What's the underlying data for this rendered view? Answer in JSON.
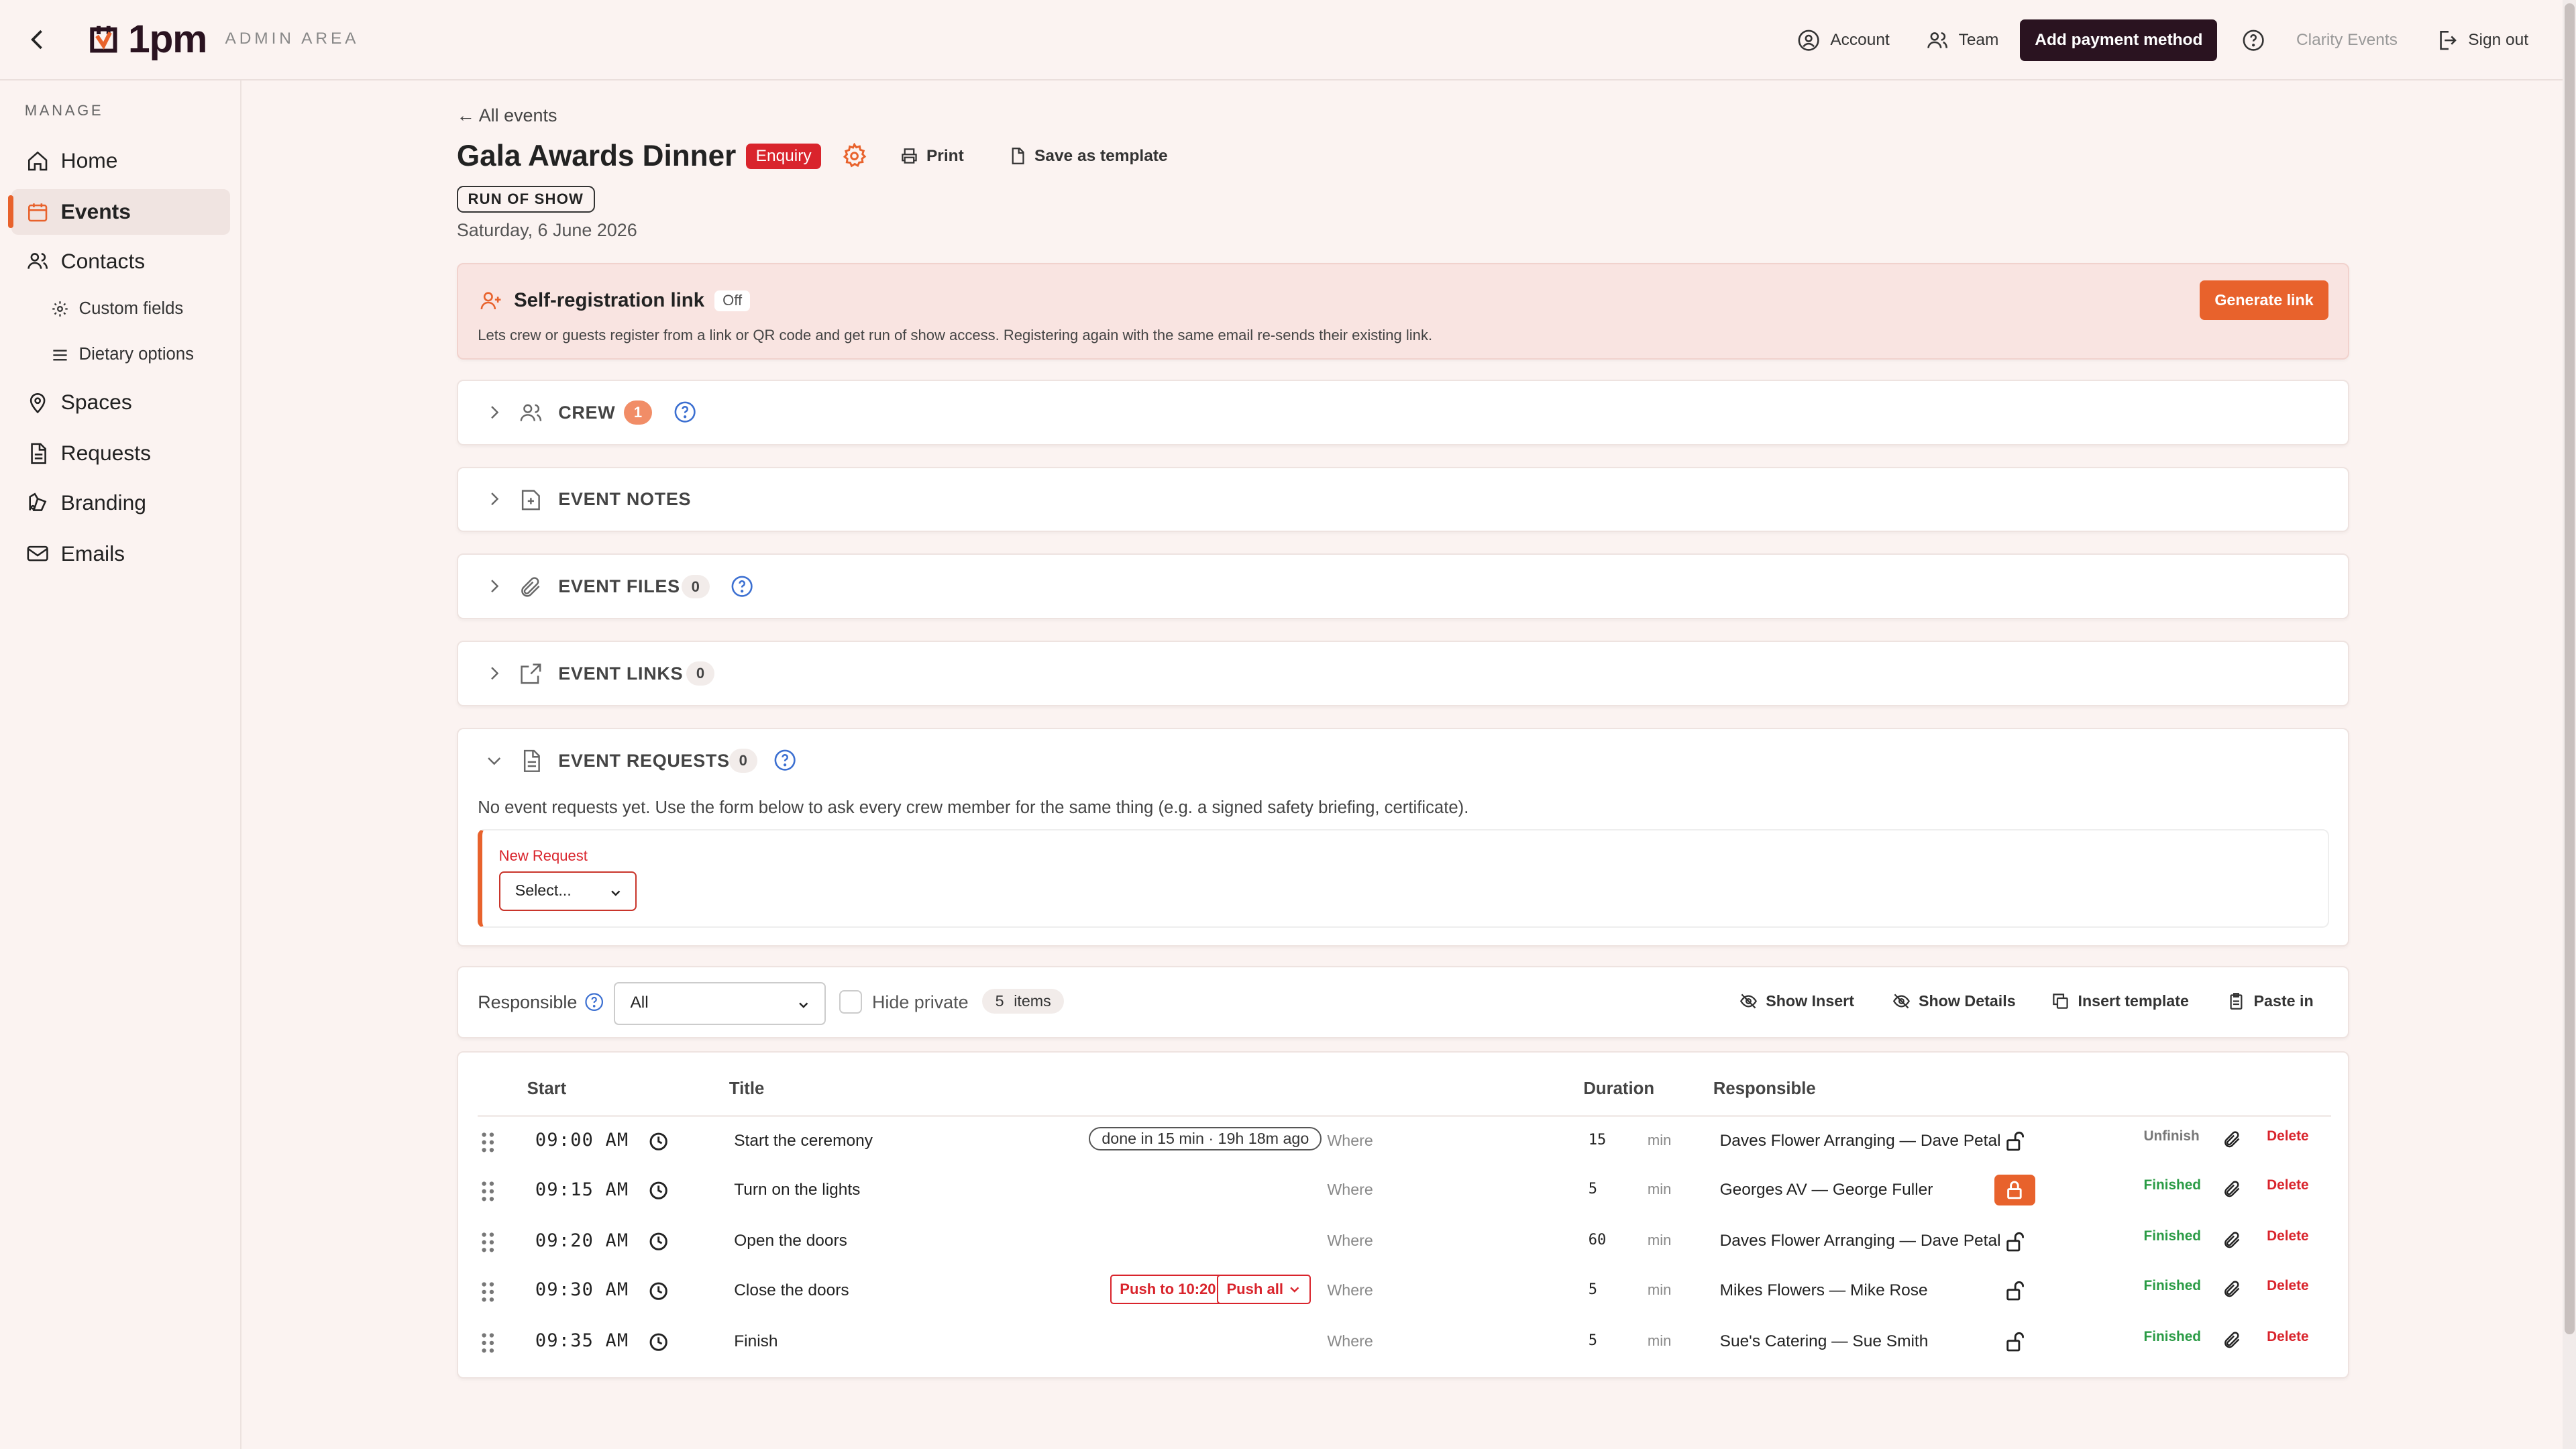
{
  "topbar": {
    "logo_text": "1pm",
    "area_label": "ADMIN AREA",
    "account": "Account",
    "team": "Team",
    "add_payment": "Add payment method",
    "org_name": "Clarity Events",
    "sign_out": "Sign out"
  },
  "sidebar": {
    "section_label": "MANAGE",
    "items": [
      {
        "label": "Home",
        "icon": "home-icon"
      },
      {
        "label": "Events",
        "icon": "calendar-icon",
        "active": true
      },
      {
        "label": "Contacts",
        "icon": "users-icon"
      },
      {
        "label": "Custom fields",
        "icon": "gear-icon"
      },
      {
        "label": "Dietary options",
        "icon": "list-icon"
      },
      {
        "label": "Spaces",
        "icon": "location-pin-icon"
      },
      {
        "label": "Requests",
        "icon": "document-icon"
      },
      {
        "label": "Branding",
        "icon": "palette-icon"
      },
      {
        "label": "Emails",
        "icon": "mail-icon"
      }
    ]
  },
  "event": {
    "back_link": "← All events",
    "title": "Gala Awards Dinner",
    "status": "Enquiry",
    "print": "Print",
    "save_template": "Save as template",
    "tag": "RUN OF SHOW",
    "date": "Saturday, 6 June 2026"
  },
  "self_registration": {
    "title": "Self-registration link",
    "state": "Off",
    "description": "Lets crew or guests register from a link or QR code and get run of show access. Registering again with the same email re-sends their existing link.",
    "button": "Generate link"
  },
  "sections": [
    {
      "label": "CREW",
      "count": "1"
    },
    {
      "label": "EVENT NOTES"
    },
    {
      "label": "EVENT FILES",
      "count": "0"
    },
    {
      "label": "EVENT LINKS",
      "count": "0"
    },
    {
      "label": "EVENT REQUESTS",
      "count": "0"
    }
  ],
  "requests": {
    "empty_text": "No event requests yet. Use the form below to ask every crew member for the same thing (e.g. a signed safety briefing, certificate).",
    "new_label": "New Request",
    "select_placeholder": "Select..."
  },
  "filters": {
    "responsible_label": "Responsible",
    "responsible_value": "All",
    "hide_private": "Hide private",
    "item_count": "5",
    "items_label": "items",
    "show_insert": "Show Insert",
    "show_details": "Show Details",
    "insert_template": "Insert template",
    "paste_in": "Paste in"
  },
  "table": {
    "headers": {
      "start": "Start",
      "title": "Title",
      "duration": "Duration",
      "responsible": "Responsible"
    },
    "where_label": "Where",
    "min_label": "min",
    "delete_label": "Delete",
    "rows": [
      {
        "time": "09:00 AM",
        "title": "Start the ceremony",
        "pill": "done in 15 min · 19h 18m ago",
        "duration": "15",
        "responsible": "Daves Flower Arranging — Dave Petal",
        "status": "Unfinish",
        "locked": false
      },
      {
        "time": "09:15 AM",
        "title": "Turn on the lights",
        "duration": "5",
        "responsible": "Georges AV — George Fuller",
        "status": "Finished",
        "locked": true
      },
      {
        "time": "09:20 AM",
        "title": "Open the doors",
        "duration": "60",
        "responsible": "Daves Flower Arranging — Dave Petal",
        "status": "Finished",
        "locked": false
      },
      {
        "time": "09:30 AM",
        "title": "Close the doors",
        "push_to": "Push to 10:20",
        "push_all": "Push all",
        "duration": "5",
        "responsible": "Mikes Flowers — Mike Rose",
        "status": "Finished",
        "locked": false
      },
      {
        "time": "09:35 AM",
        "title": "Finish",
        "duration": "5",
        "responsible": "Sue's Catering — Sue Smith",
        "status": "Finished",
        "locked": false
      }
    ]
  },
  "colors": {
    "accent": "#e8622c",
    "brand_dark": "#2a1320",
    "danger": "#d9242c",
    "success": "#2a9b45",
    "link_blue": "#3b6fd1"
  }
}
